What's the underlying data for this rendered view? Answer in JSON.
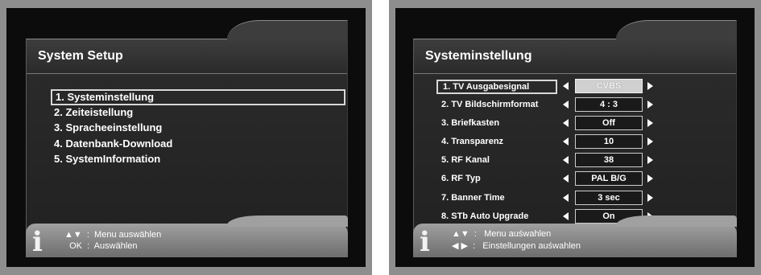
{
  "left_screen": {
    "title": "System Setup",
    "menu_items": [
      {
        "label": "1.  Systeminstellung"
      },
      {
        "label": "2.  Zeiteistellung"
      },
      {
        "label": "3.  Spracheeinstellung"
      },
      {
        "label": "4.  Datenbank-Download"
      },
      {
        "label": "5.  SystemInformation"
      }
    ],
    "footer": {
      "line1": "▲▼  :  Menu auswählen",
      "line2": "  OK  :  Auswählen"
    }
  },
  "right_screen": {
    "title": "Systeminstellung",
    "settings": [
      {
        "label": "1.  TV Ausgabesignal",
        "value": "CVBS"
      },
      {
        "label": "2.  TV Bildschirmformat",
        "value": "4 : 3"
      },
      {
        "label": "3.   Briefkasten",
        "value": "Off"
      },
      {
        "label": "4.  Transparenz",
        "value": "10"
      },
      {
        "label": "5.  RF Kanal",
        "value": "38"
      },
      {
        "label": "6.  RF Typ",
        "value": "PAL B/G"
      },
      {
        "label": "7.  Banner Time",
        "value": "3 sec"
      },
      {
        "label": "8.  STb Auto Upgrade",
        "value": "On"
      }
    ],
    "footer": {
      "line1": "▲▼  :   Menu auśwahlen",
      "line2": "◀ ▶  :   Einstellungen auśwahlen"
    }
  },
  "icons": {
    "info": "info-icon",
    "left": "arrow-left-icon",
    "right": "arrow-right-icon"
  }
}
